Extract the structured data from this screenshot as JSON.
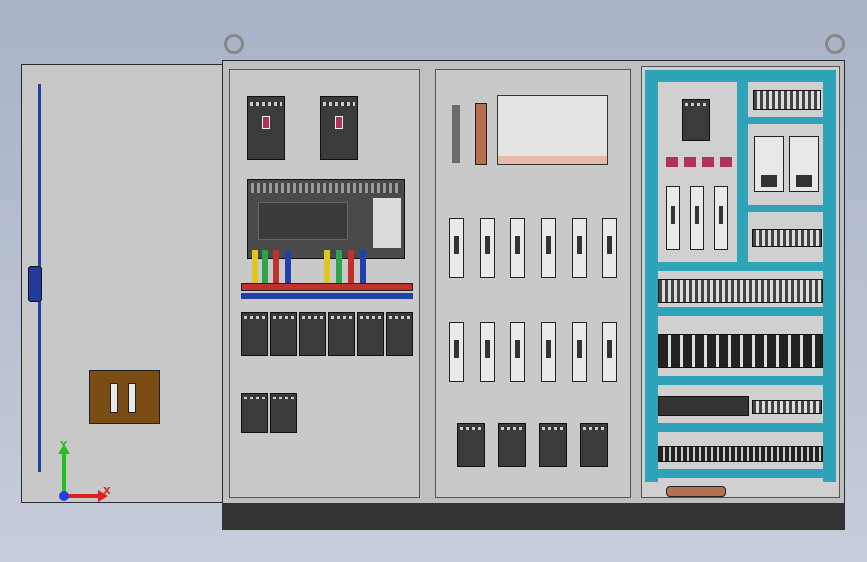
{
  "axis_indicator": {
    "x_label": "X",
    "y_label": "Y",
    "x_color": "#e02020",
    "y_color": "#22c022",
    "z_color": "#2040e0"
  },
  "colors": {
    "panel_gray": "#c8c8c8",
    "wire_duct": "#2fa4b8",
    "busbar_red": "#c0302c",
    "handle_blue": "#2140a8",
    "nameplate_brown": "#7a4d15"
  }
}
